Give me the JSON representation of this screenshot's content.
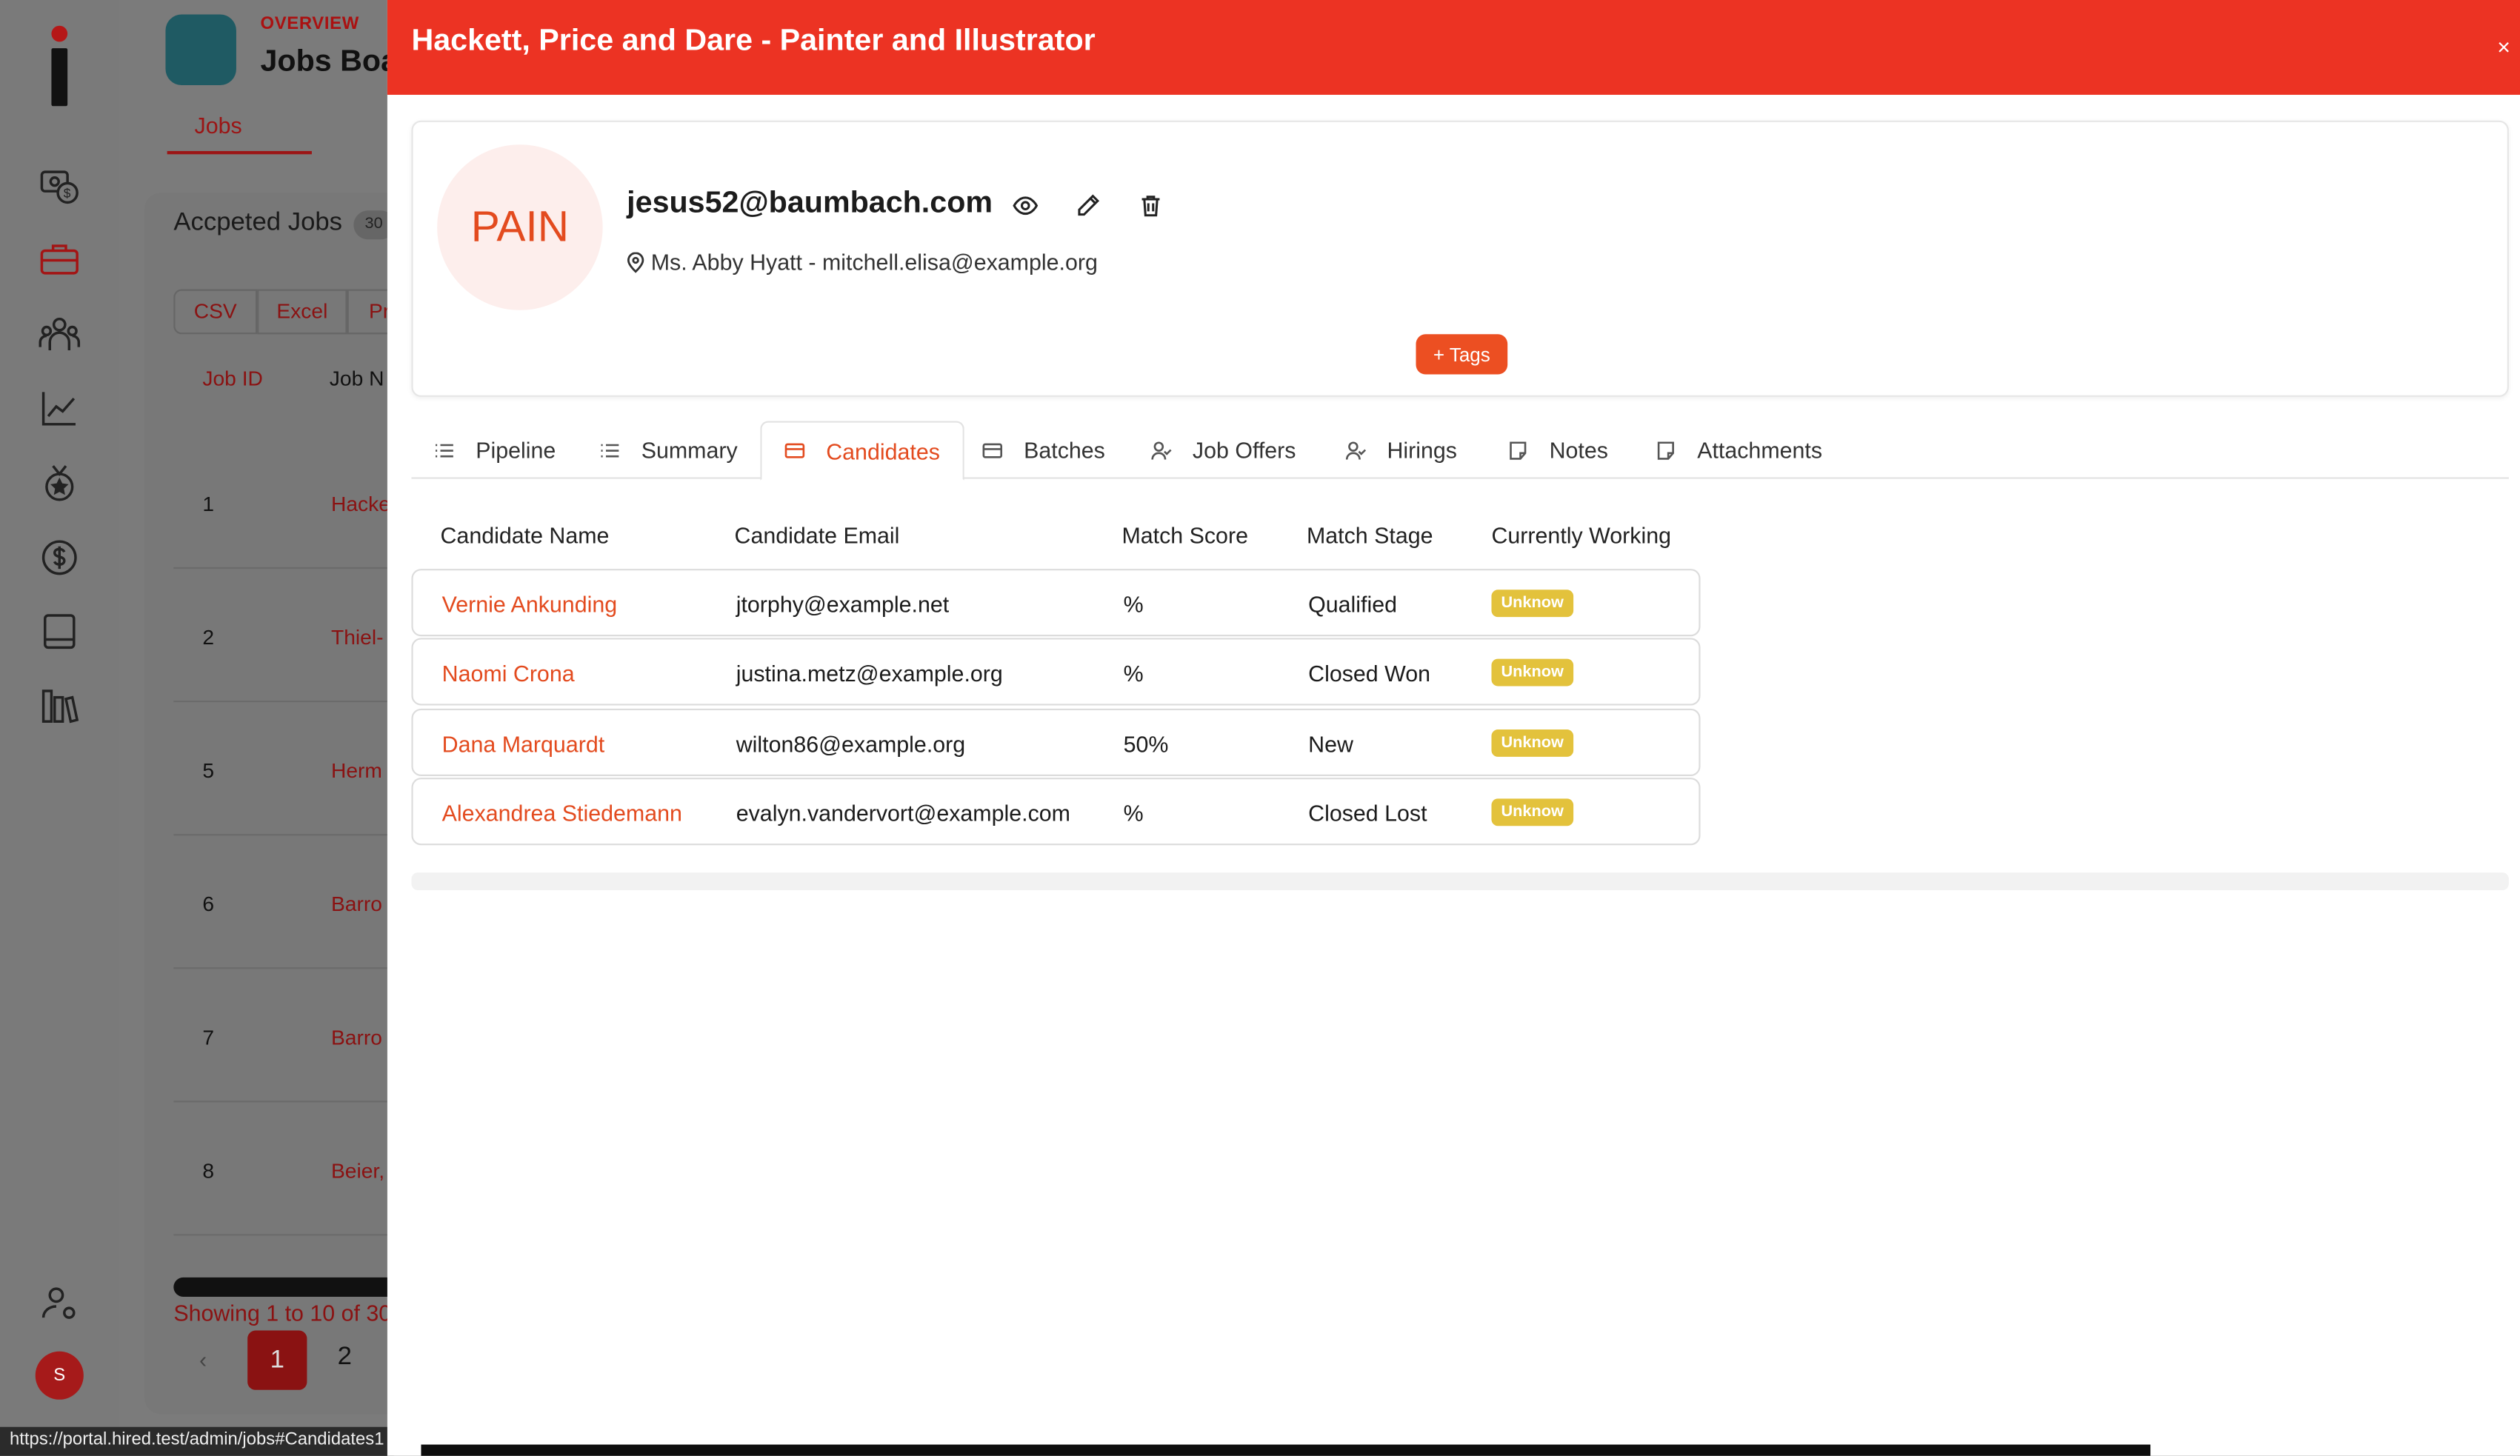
{
  "sidebar": {
    "avatar_initial": "S",
    "icons": [
      "cash-icon",
      "briefcase-icon",
      "users-icon",
      "chart-icon",
      "medal-icon",
      "dollar-icon",
      "book-icon",
      "library-icon",
      "user-settings-icon"
    ]
  },
  "background": {
    "overview_label": "OVERVIEW",
    "page_title": "Jobs Boa",
    "tab_jobs": "Jobs",
    "card_title": "Accpeted Jobs",
    "card_badge": "30",
    "export_buttons": [
      "CSV",
      "Excel",
      "Pr"
    ],
    "col_job_id": "Job ID",
    "col_job_name": "Job N",
    "rows": [
      {
        "id": "1",
        "name": "Hacke"
      },
      {
        "id": "2",
        "name": "Thiel-"
      },
      {
        "id": "5",
        "name": "Herm"
      },
      {
        "id": "6",
        "name": "Barro"
      },
      {
        "id": "7",
        "name": "Barro"
      },
      {
        "id": "8",
        "name": "Beier,"
      }
    ],
    "showing_text": "Showing 1 to 10 of 30",
    "pagination": {
      "prev": "‹",
      "current": "1",
      "next_page": "2"
    }
  },
  "status_url": "https://portal.hired.test/admin/jobs#Candidates1",
  "modal": {
    "title": "Hackett, Price and Dare - Painter and Illustrator",
    "close": "×",
    "profile": {
      "initials": "PAIN",
      "email": "jesus52@baumbach.com",
      "contact": "Ms. Abby Hyatt - mitchell.elisa@example.org",
      "tags_button": "+ Tags"
    },
    "tabs": [
      "Pipeline",
      "Summary",
      "Candidates",
      "Batches",
      "Job Offers",
      "Hirings",
      "Notes",
      "Attachments"
    ],
    "active_tab": "Candidates",
    "table": {
      "headers": [
        "Candidate Name",
        "Candidate Email",
        "Match Score",
        "Match Stage",
        "Currently Working"
      ],
      "rows": [
        {
          "name": "Vernie Ankunding",
          "email": "jtorphy@example.net",
          "score": "%",
          "stage": "Qualified",
          "working": "Unknow"
        },
        {
          "name": "Naomi Crona",
          "email": "justina.metz@example.org",
          "score": "%",
          "stage": "Closed Won",
          "working": "Unknow"
        },
        {
          "name": "Dana Marquardt",
          "email": "wilton86@example.org",
          "score": "50%",
          "stage": "New",
          "working": "Unknow"
        },
        {
          "name": "Alexandrea Stiedemann",
          "email": "evalyn.vandervort@example.com",
          "score": "%",
          "stage": "Closed Lost",
          "working": "Unknow"
        }
      ]
    }
  },
  "colors": {
    "accent": "#ec3323",
    "link": "#e34b1f",
    "badge": "#e3c23c"
  }
}
